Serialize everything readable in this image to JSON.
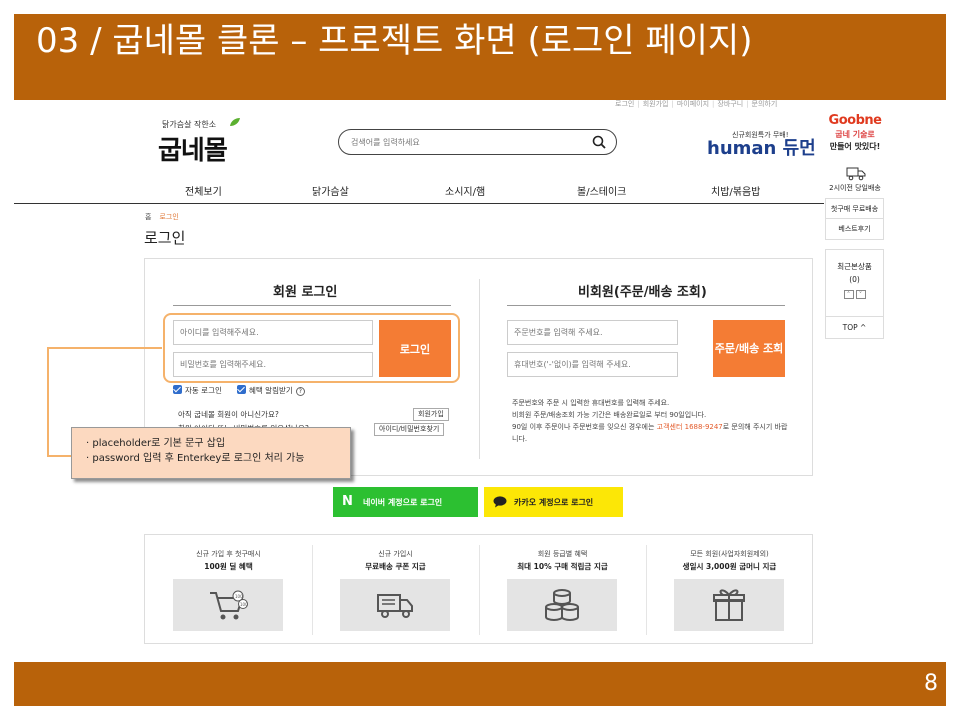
{
  "slide": {
    "title": "03 / 굽네몰 클론 – 프로젝트 화면 (로그인 페이지)",
    "page_number": "8",
    "header_color": "#b8620a"
  },
  "site": {
    "util_links": [
      "로그인",
      "회원가입",
      "마이페이지",
      "장바구니",
      "문의하기"
    ],
    "logo_slogan": "닭가슴살 작한소",
    "logo": "굽네몰",
    "search_placeholder": "검색어를 입력하세요",
    "human_promo": "신규회원특가 무배!",
    "human_logo": "human 듀먼",
    "goobne_logo": "Goobne",
    "goobne_sub1": "굽네 기술로",
    "goobne_sub2": "만들어 맛있다!",
    "delivery": "2시이전 당일배송",
    "nav": [
      "전체보기",
      "닭가슴살",
      "소시지/햄",
      "볼/스테이크",
      "치밥/볶음밥"
    ]
  },
  "side": {
    "links": [
      "첫구매 무료배송",
      "베스트후기"
    ],
    "recent_label": "최근본상품",
    "recent_count": "(0)",
    "top": "TOP ^"
  },
  "breadcrumb": {
    "home": "홈",
    "current": "로그인"
  },
  "page_heading": "로그인",
  "member": {
    "title": "회원 로그인",
    "id_placeholder": "아이디를 입력해주세요.",
    "pw_placeholder": "비밀번호를 입력해주세요.",
    "login_button": "로그인",
    "auto_login": "자동 로그인",
    "notify": "혜택 알림받기",
    "question": "아직 굽네몰 회원이 아니신가요?",
    "signup_button": "회원가입",
    "question2": "회원 아이디 또는 비밀번호를 잊으셨나요?",
    "find_button": "아이디/비밀번호찾기"
  },
  "guest": {
    "title": "비회원(주문/배송 조회)",
    "order_placeholder": "주문번호를 입력해 주세요.",
    "phone_placeholder": "휴대번호('-'없이)를 입력해 주세요.",
    "order_button": "주문/배송 조회",
    "info1": "주문번호와 주문 시 입력한 휴대번호를 입력해 주세요.",
    "info2": "비회원 주문/배송조회 가능 기간은 배송완료일로 부터 90일입니다.",
    "info3_a": "90일 이후 주문이나 주문번호를 잊으신 경우에는 ",
    "info3_hl": "고객센터 1688-9247",
    "info3_b": "로 문의해 주시기 바랍니다."
  },
  "tooltip": {
    "line1": "· placeholder로 기본 문구 삽입",
    "line2": "· password 입력 후 Enterkey로 로그인 처리 가능"
  },
  "social": {
    "naver": "네이버 계정으로 로그인",
    "naver_color": "#2cc031",
    "kakao": "카카오 계정으로 로그인",
    "kakao_color": "#fce706"
  },
  "benefits": [
    {
      "sub": "신규 가입 후 첫구매시",
      "title": "100원 딜 혜택",
      "icon": "cart-icon"
    },
    {
      "sub": "신규 가입시",
      "title": "무료배송 쿠폰 지급",
      "icon": "truck-icon"
    },
    {
      "sub": "회원 등급별 혜택",
      "title": "최대 10% 구매 적립금 지급",
      "icon": "coins-icon"
    },
    {
      "sub": "모든 회원(사업자회원제외)",
      "title": "생일시 3,000원 굽머니 지급",
      "icon": "gift-icon"
    }
  ],
  "accent_color": "#f47c34"
}
